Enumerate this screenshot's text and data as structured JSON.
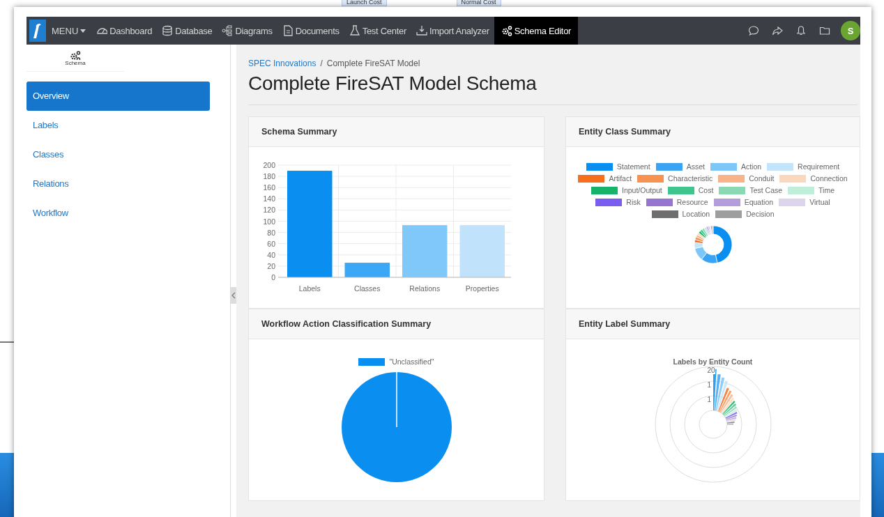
{
  "backdrop": {
    "chips": [
      "Launch Cost",
      "Normal Cost"
    ]
  },
  "navbar": {
    "menu": "MENU",
    "items": [
      {
        "label": "Dashboard",
        "selected": false
      },
      {
        "label": "Database",
        "selected": false
      },
      {
        "label": "Diagrams",
        "selected": false
      },
      {
        "label": "Documents",
        "selected": false
      },
      {
        "label": "Test Center",
        "selected": false
      },
      {
        "label": "Import Analyzer",
        "selected": false
      },
      {
        "label": "Schema Editor",
        "selected": true
      }
    ],
    "avatar": "S"
  },
  "sidebar": {
    "tab": "Schema",
    "items": [
      {
        "label": "Overview",
        "selected": true
      },
      {
        "label": "Labels",
        "selected": false
      },
      {
        "label": "Classes",
        "selected": false
      },
      {
        "label": "Relations",
        "selected": false
      },
      {
        "label": "Workflow",
        "selected": false
      }
    ]
  },
  "breadcrumb": [
    {
      "kind": "link",
      "text": "SPEC Innovations"
    },
    {
      "kind": "separator",
      "text": "/"
    },
    {
      "kind": "current",
      "text": "Complete FireSAT Model"
    }
  ],
  "title": "Complete FireSAT Model Schema",
  "cards": [
    {
      "kind": "bar",
      "title": "Schema Summary",
      "chart_data": {
        "type": "bar",
        "categories": [
          "Labels",
          "Classes",
          "Relations",
          "Properties"
        ],
        "values": [
          190,
          26,
          93,
          93
        ],
        "ylim": [
          0,
          200
        ],
        "yticks": [
          0,
          20,
          40,
          60,
          80,
          100,
          120,
          140,
          160,
          180,
          200
        ],
        "grid": true
      }
    },
    {
      "kind": "donut",
      "title": "Entity Class Summary",
      "legend": [
        {
          "label": "Statement",
          "color": "#0a8ff0"
        },
        {
          "label": "Asset",
          "color": "#3aa3f2"
        },
        {
          "label": "Action",
          "color": "#7cc6f8"
        },
        {
          "label": "Requirement",
          "color": "#c3e4fb"
        },
        {
          "label": "Artifact",
          "color": "#f76e1d"
        },
        {
          "label": "Characteristic",
          "color": "#f89250"
        },
        {
          "label": "Conduit",
          "color": "#f8b488"
        },
        {
          "label": "Connection",
          "color": "#fbd7bd"
        },
        {
          "label": "Input/Output",
          "color": "#18b36b"
        },
        {
          "label": "Cost",
          "color": "#3fc58d"
        },
        {
          "label": "Test Case",
          "color": "#8ad9b4"
        },
        {
          "label": "Time",
          "color": "#bfeedb"
        },
        {
          "label": "Risk",
          "color": "#7a5cf0"
        },
        {
          "label": "Resource",
          "color": "#9575cd"
        },
        {
          "label": "Equation",
          "color": "#b39ddb"
        },
        {
          "label": "Virtual",
          "color": "#ddd5ec"
        },
        {
          "label": "Location",
          "color": "#6e6e6e"
        },
        {
          "label": "Decision",
          "color": "#9e9e9e"
        }
      ]
    },
    {
      "kind": "pie",
      "title": "Workflow Action Classification Summary",
      "legend": [
        {
          "label": "\"Unclassified\"",
          "color": "#0a8ff0"
        }
      ]
    },
    {
      "kind": "polar",
      "title": "Entity Label Summary",
      "chart_title": "Labels by Entity Count",
      "ticks": [
        "20",
        "1",
        "1"
      ]
    }
  ]
}
